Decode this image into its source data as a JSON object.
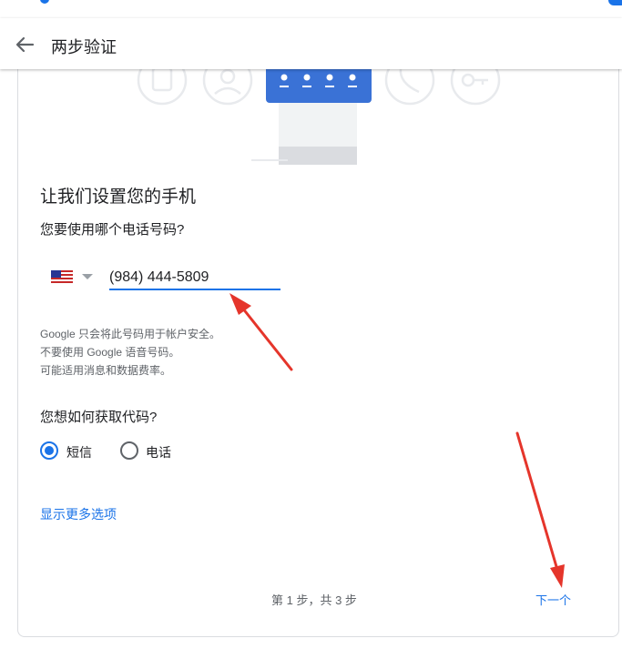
{
  "header": {
    "title": "两步验证"
  },
  "setup": {
    "title": "让我们设置您的手机",
    "question_phone": "您要使用哪个电话号码?",
    "phone_value": "(984) 444-5809",
    "notes": [
      "Google 只会将此号码用于帐户安全。",
      "不要使用 Google 语音号码。",
      "可能适用消息和数据费率。"
    ],
    "question_code": "您想如何获取代码?",
    "option_sms": "短信",
    "option_call": "电话",
    "selected_option": "短信",
    "more_options": "显示更多选项",
    "step_text": "第 1 步，共 3 步",
    "next_label": "下一个"
  },
  "colors": {
    "accent": "#1a73e8",
    "annotation": "#e5352b"
  },
  "icons": [
    "back-arrow-icon",
    "us-flag-icon",
    "dropdown-caret-icon"
  ]
}
